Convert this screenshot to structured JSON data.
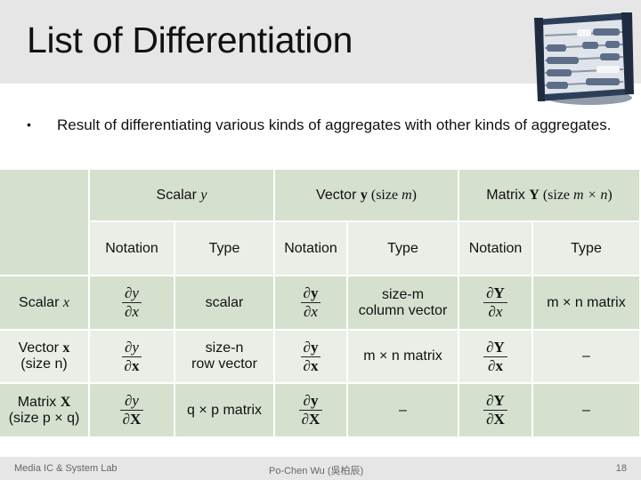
{
  "slide": {
    "title": "List of Differentiation",
    "bullet": "Result of differentiating various kinds of aggregates with other kinds of aggregates.",
    "bullet_marker": "•",
    "logo_icon": "abacus-icon"
  },
  "table": {
    "header_groups": [
      {
        "prefix": "Scalar ",
        "symbol": "y",
        "symbol_style": "italic",
        "suffix": ""
      },
      {
        "prefix": "Vector ",
        "symbol": "y",
        "symbol_style": "bold",
        "suffix_pre": " (size ",
        "suffix_var": "m",
        "suffix_post": ")"
      },
      {
        "prefix": "Matrix ",
        "symbol": "Y",
        "symbol_style": "bold",
        "suffix_pre": " (size ",
        "suffix_var": "m × n",
        "suffix_post": ")"
      }
    ],
    "subheaders": [
      "Notation",
      "Type",
      "Notation",
      "Type",
      "Notation",
      "Type"
    ],
    "rows": [
      {
        "label_line1_prefix": "Scalar ",
        "label_line1_symbol": "x",
        "label_line2": "",
        "cells": [
          {
            "num": "∂y",
            "den": "∂x"
          },
          {
            "text": "scalar"
          },
          {
            "num": "∂y",
            "den": "∂x"
          },
          {
            "text_line1": "size-m",
            "text_line2": "column vector"
          },
          {
            "num": "∂Y",
            "den": "∂x"
          },
          {
            "text": "m × n matrix"
          }
        ]
      },
      {
        "label_line1_prefix": "Vector ",
        "label_line1_symbol": "x",
        "label_line2": "(size n)",
        "cells": [
          {
            "num": "∂y",
            "den": "∂x"
          },
          {
            "text_line1": "size-n",
            "text_line2": "row vector"
          },
          {
            "num": "∂y",
            "den": "∂x"
          },
          {
            "text": "m × n matrix"
          },
          {
            "num": "∂Y",
            "den": "∂x"
          },
          {
            "text": "–"
          }
        ]
      },
      {
        "label_line1_prefix": "Matrix ",
        "label_line1_symbol": "X",
        "label_line2": "(size p × q)",
        "cells": [
          {
            "num": "∂y",
            "den": "∂X"
          },
          {
            "text": "q × p matrix"
          },
          {
            "num": "∂y",
            "den": "∂X"
          },
          {
            "text": "–"
          },
          {
            "num": "∂Y",
            "den": "∂X"
          },
          {
            "text": "–"
          }
        ]
      }
    ]
  },
  "footer": {
    "left": "Media IC & System Lab",
    "center": "Po-Chen Wu (吳柏辰)",
    "page_number": "18"
  },
  "colors": {
    "title_band": "#e6e6e6",
    "cell_dark": "#d6e0cf",
    "cell_light": "#e9eee6",
    "frame_dark": "#2d3e58"
  }
}
